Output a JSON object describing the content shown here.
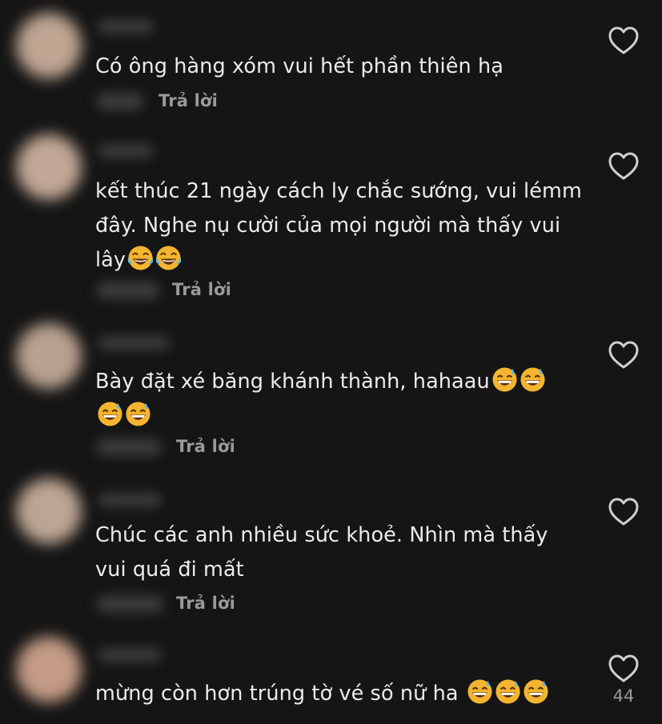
{
  "comments": [
    {
      "text": "Có ông hàng xóm vui hết phần thiên hạ",
      "emojis": [],
      "reply_label": "Trả lời",
      "like_icon": "heart-outline-icon",
      "like_count": ""
    },
    {
      "text": "kết thúc 21 ngày cách ly chắc sướng, vui lémm đây. Nghe nụ cười của mọi người mà thấy vui lây",
      "emojis": [
        "face-with-tears-of-joy",
        "face-with-tears-of-joy"
      ],
      "reply_label": "Trả lời",
      "like_icon": "heart-outline-icon",
      "like_count": ""
    },
    {
      "text": "Bày đặt xé băng khánh thành, hahaau",
      "emojis": [
        "grinning-face-with-sweat",
        "grinning-face-with-sweat",
        "grinning-face-with-sweat",
        "grinning-face-with-sweat"
      ],
      "reply_label": "Trả lời",
      "like_icon": "heart-outline-icon",
      "like_count": ""
    },
    {
      "text": "Chúc các anh nhiều sức khoẻ. Nhìn mà thấy vui quá đi mất",
      "emojis": [],
      "reply_label": "Trả lời",
      "like_icon": "heart-outline-icon",
      "like_count": ""
    },
    {
      "text": "mừng còn hơn trúng tờ vé số nữ ha ",
      "emojis": [
        "grinning-face-with-sweat",
        "grinning-face-with-sweat",
        "grinning-face-with-sweat"
      ],
      "reply_label": "",
      "like_icon": "heart-outline-icon",
      "like_count": "44"
    }
  ],
  "colors": {
    "background": "#151515",
    "text": "#ececec",
    "muted": "#9a9a9a",
    "heart_stroke": "#d0d0d0"
  }
}
